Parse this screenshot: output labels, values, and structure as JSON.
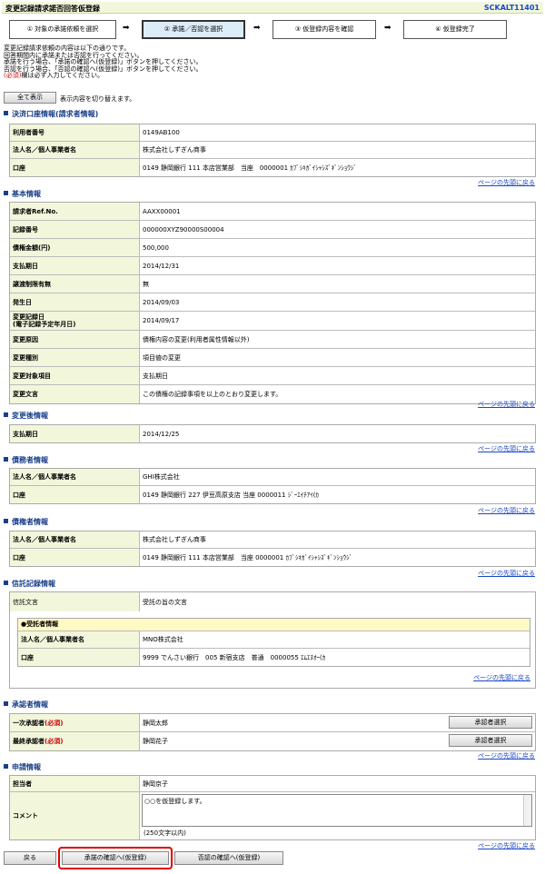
{
  "header": {
    "title": "変更記録請求諾否回答仮登録",
    "screen_id": "SCKALT11401"
  },
  "steps": [
    {
      "label": "① 対象の承諾依頼を選択"
    },
    {
      "label": "② 承諾／否認を選択"
    },
    {
      "label": "③ 仮登録内容を確認"
    },
    {
      "label": "④ 仮登録完了"
    }
  ],
  "arrow": "➡",
  "intro": {
    "line1": "変更記録請求依頼の内容は以下の通りです。",
    "line2": "回答期間内に承諾または否認を行ってください。",
    "line3": "承諾を行う場合、「承諾の確認へ(仮登録)」ボタンを押してください。",
    "line4": "否認を行う場合、「否認の確認へ(仮登録)」ボタンを押してください。",
    "line5_req": "(必須)",
    "line5_rest": "欄は必ず入力してください。"
  },
  "show_all": {
    "button": "全て表示",
    "desc": "表示内容を切り替えます。"
  },
  "top_link": "ページの先頭に戻る",
  "sections": {
    "settlement": {
      "title": "決済口座情報(請求者情報)",
      "rows": [
        {
          "k": "利用者番号",
          "v": "0149AB100"
        },
        {
          "k": "法人名／個人事業者名",
          "v": "株式会社しずぎん商事"
        },
        {
          "k": "口座",
          "v": "0149 静岡銀行 111 本店営業部　当座　0000001 ｶﾌﾞｼｷｶﾞｲｼｬｼｽﾞｷﾞﾝｼｮｳｼﾞ"
        }
      ]
    },
    "basic": {
      "title": "基本情報",
      "rows": [
        {
          "k": "請求者Ref.No.",
          "v": "AAXX00001"
        },
        {
          "k": "記録番号",
          "v": "000000XYZ90000S00004"
        },
        {
          "k": "債権金額(円)",
          "v": "500,000"
        },
        {
          "k": "支払期日",
          "v": "2014/12/31"
        },
        {
          "k": "譲渡制限有無",
          "v": "無"
        },
        {
          "k": "発生日",
          "v": "2014/09/03"
        },
        {
          "k": "変更記録日",
          "k2": "(電子記録予定年月日)",
          "v": "2014/09/17"
        },
        {
          "k": "変更原因",
          "v": "債権内容の変更(利用者属性情報以外)"
        },
        {
          "k": "変更種別",
          "v": "項目値の変更"
        },
        {
          "k": "変更対象項目",
          "v": "支払期日"
        },
        {
          "k": "変更文言",
          "v": "この債権の記録事項を以上のとおり変更します。"
        }
      ]
    },
    "after": {
      "title": "変更後情報",
      "rows": [
        {
          "k": "支払期日",
          "v": "2014/12/25"
        }
      ]
    },
    "debtor": {
      "title": "債務者情報",
      "rows": [
        {
          "k": "法人名／個人事業者名",
          "v": "GHI株式会社"
        },
        {
          "k": "口座",
          "v": "0149 静岡銀行 227 伊豆高原支店 当座 0000011 ｼﾞｰｴｲﾁｱｲ(ｶ"
        }
      ]
    },
    "creditor": {
      "title": "債権者情報",
      "rows": [
        {
          "k": "法人名／個人事業者名",
          "v": "株式会社しずぎん商事"
        },
        {
          "k": "口座",
          "v": "0149 静岡銀行 111 本店営業部　当座 0000001 ｶﾌﾞｼｷｶﾞｲｼｬｼｽﾞｷﾞﾝｼｮｳｼﾞ"
        }
      ]
    },
    "trust": {
      "title": "信託記録情報",
      "text_k": "信託文言",
      "text_v": "受託の旨の文言",
      "sub_title": "●受託者情報",
      "sub_rows": [
        {
          "k": "法人名／個人事業者名",
          "v": "MNO株式会社"
        },
        {
          "k": "口座",
          "v": "9999 でんさい銀行　005 新宿支店　普通　0000055 ｴﾑｴﾇｵｰ(ｶ"
        }
      ]
    },
    "approver": {
      "title": "承認者情報",
      "rows": [
        {
          "k": "一次承認者",
          "v": "静岡太郎",
          "btn": "承認者選択"
        },
        {
          "k": "最終承認者",
          "v": "静岡花子",
          "btn": "承認者選択"
        }
      ],
      "req": "(必須)"
    },
    "application": {
      "title": "申請情報",
      "person_k": "担当者",
      "person_v": "静岡京子",
      "comment_k": "コメント",
      "comment_v": "○○を仮登録します。",
      "limit": "(250文字以内)"
    }
  },
  "buttons": {
    "back": "戻る",
    "approve": "承諾の確認へ(仮登録)",
    "deny": "否認の確認へ(仮登録)"
  }
}
